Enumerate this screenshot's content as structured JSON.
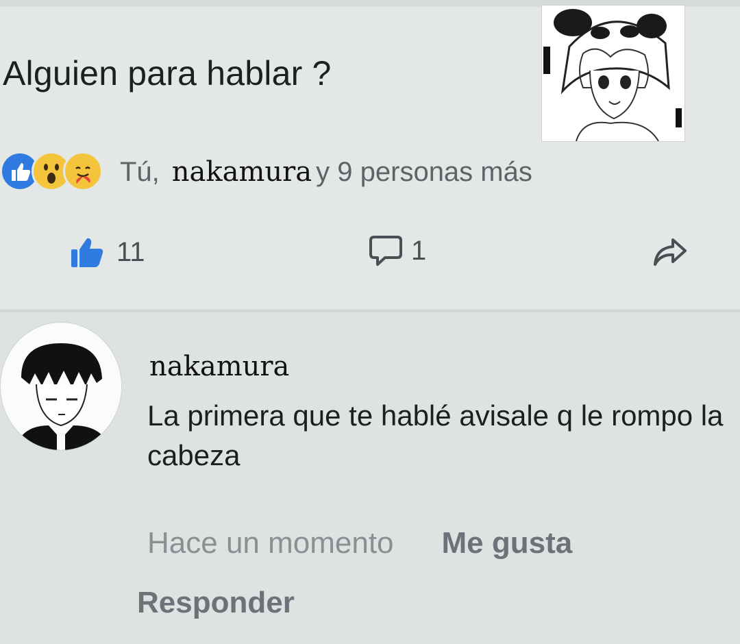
{
  "post": {
    "text": "Alguien para hablar ?"
  },
  "reactions": {
    "icons": [
      "like-reaction-icon",
      "wow-reaction-icon",
      "care-reaction-icon"
    ],
    "names_prefix": "Tú,",
    "tagged_name": "nakamura",
    "names_suffix": "y 9 personas más"
  },
  "actions": {
    "like_count": "11",
    "comment_count": "1"
  },
  "comment": {
    "author": "nakamura",
    "body": "La primera que te hablé avisale q le rompo la cabeza",
    "timestamp": "Hace un momento",
    "like_label": "Me gusta",
    "reply_label": "Responder"
  },
  "colors": {
    "like_blue": "#2f7be0",
    "reaction_yellow": "#f3c43c",
    "muted_text": "#8a8f94"
  }
}
